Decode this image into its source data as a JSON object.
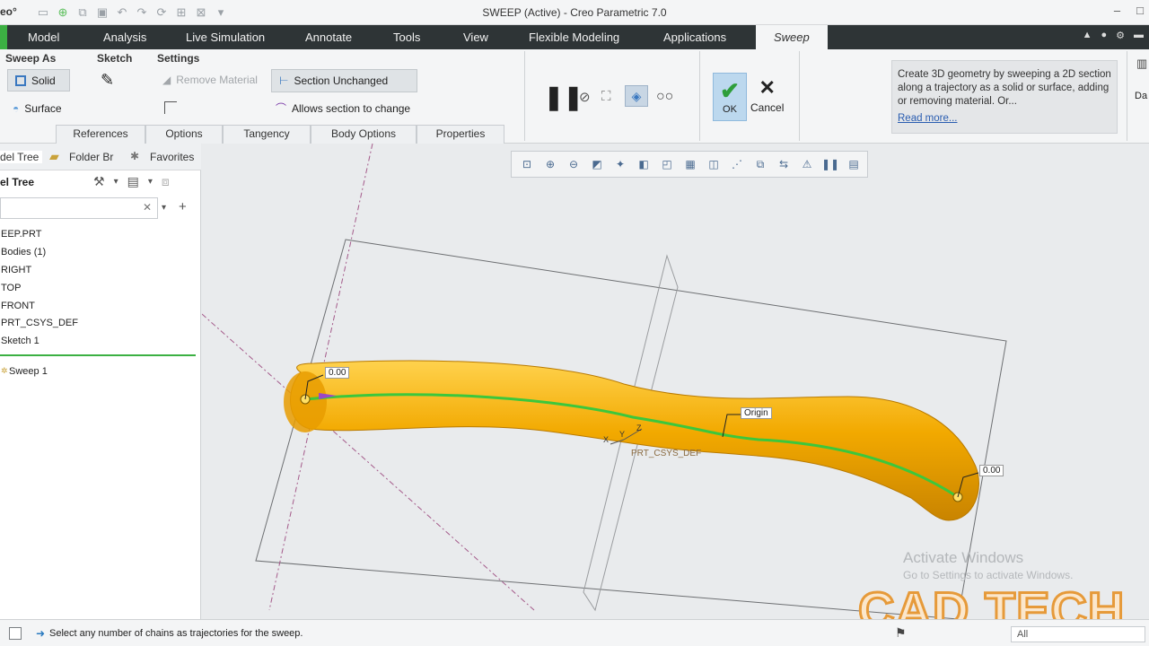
{
  "app": {
    "logo": "eo°",
    "window_title": "SWEEP (Active) - Creo Parametric 7.0",
    "window_controls": [
      "–",
      "□"
    ]
  },
  "qat_icons": [
    "new-icon",
    "open-icon",
    "open-session-icon",
    "save-icon",
    "undo-icon",
    "redo-icon",
    "regenerate-icon",
    "windows-icon",
    "close-window-icon",
    "customize-icon"
  ],
  "ribbon_tabs": [
    {
      "label": "Model"
    },
    {
      "label": "Analysis"
    },
    {
      "label": "Live Simulation"
    },
    {
      "label": "Annotate"
    },
    {
      "label": "Tools"
    },
    {
      "label": "View"
    },
    {
      "label": "Flexible Modeling"
    },
    {
      "label": "Applications"
    },
    {
      "label": "Sweep",
      "active": true
    }
  ],
  "ribbon": {
    "groups": {
      "sweep_as": "Sweep As",
      "sketch": "Sketch",
      "settings": "Settings"
    },
    "solid_label": "Solid",
    "surface_label": "Surface",
    "remove_material_label": "Remove Material",
    "section_unchanged_label": "Section Unchanged",
    "allows_section_label": "Allows section to change",
    "ok_label": "OK",
    "cancel_label": "Cancel",
    "dashboard_partial": "Da",
    "dashboard_tabs": [
      "References",
      "Options",
      "Tangency",
      "Body Options",
      "Properties"
    ],
    "help_text": "Create 3D geometry by sweeping a 2D section along a trajectory as a solid or surface, adding or removing material. Or...",
    "read_more": "Read more..."
  },
  "left_panel": {
    "tabs": [
      "del Tree",
      "Folder Br",
      "Favorites"
    ],
    "tree_title": "el Tree",
    "items": [
      "EEP.PRT",
      "Bodies (1)",
      "RIGHT",
      "TOP",
      "FRONT",
      "PRT_CSYS_DEF",
      "Sketch 1"
    ],
    "active_feature": "Sweep 1"
  },
  "viewport": {
    "labels": {
      "start_value": "0.00",
      "end_value": "0.00",
      "origin": "Origin",
      "csys": "PRT_CSYS_DEF",
      "axis_x": "X",
      "axis_y": "Y",
      "axis_z": "Z"
    },
    "colors": {
      "sweep_body": "#f2a900",
      "sweep_dark": "#c98400",
      "trajectory": "#3cc73c",
      "datum_plane": "#6d6f72"
    }
  },
  "watermark": {
    "activate_title": "Activate Windows",
    "activate_sub": "Go to Settings to activate Windows.",
    "brand": "CAD TECH"
  },
  "status": {
    "message": "Select any number of chains as trajectories for the sweep.",
    "filter": "All"
  }
}
